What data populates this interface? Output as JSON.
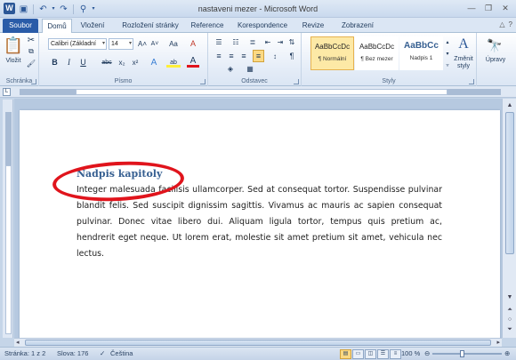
{
  "window": {
    "title": "nastaveni mezer - Microsoft Word",
    "app_icon_letter": "W"
  },
  "tabs": {
    "file": "Soubor",
    "items": [
      "Domů",
      "Vložení",
      "Rozložení stránky",
      "Reference",
      "Korespondence",
      "Revize",
      "Zobrazení"
    ]
  },
  "ribbon": {
    "clipboard": {
      "paste_label": "Vložit",
      "group_label": "Schránka"
    },
    "font": {
      "font_name": "Calibri (Základní",
      "font_size": "14",
      "bold": "B",
      "italic": "I",
      "underline": "U",
      "strike": "abc",
      "subscript": "x₂",
      "superscript": "x²",
      "grow": "A˄",
      "shrink": "A˅",
      "case": "Aa",
      "clear": "A",
      "effects": "A",
      "highlight": "ab",
      "color": "A",
      "group_label": "Písmo"
    },
    "paragraph": {
      "group_label": "Odstavec"
    },
    "styles": {
      "items": [
        {
          "sample": "AaBbCcDc",
          "name": "¶ Normální"
        },
        {
          "sample": "AaBbCcDc",
          "name": "¶ Bez mezer"
        },
        {
          "sample": "AaBbCc",
          "name": "Nadpis 1"
        }
      ],
      "change_styles": "Změnit styly",
      "group_label": "Styly"
    },
    "editing": {
      "label": "Úpravy"
    }
  },
  "document": {
    "heading": "Nadpis kapitoly",
    "body": "Integer malesuada facilisis ullamcorper. Sed at consequat tortor. Suspendisse pulvinar blandit felis. Sed suscipit dignissim sagittis. Vivamus ac mauris ac sapien consequat pulvinar. Donec vitae libero dui. Aliquam ligula tortor, tempus quis pretium ac, hendrerit eget neque. Ut lorem erat, molestie sit amet pretium sit amet, vehicula nec lectus."
  },
  "status": {
    "page": "Stránka: 1 z 2",
    "words": "Slova: 176",
    "language": "Čeština",
    "zoom": "100 %"
  },
  "colors": {
    "heading": "#365f91",
    "file_tab": "#2a5ca8",
    "highlight_ellipse": "#e0141c"
  }
}
